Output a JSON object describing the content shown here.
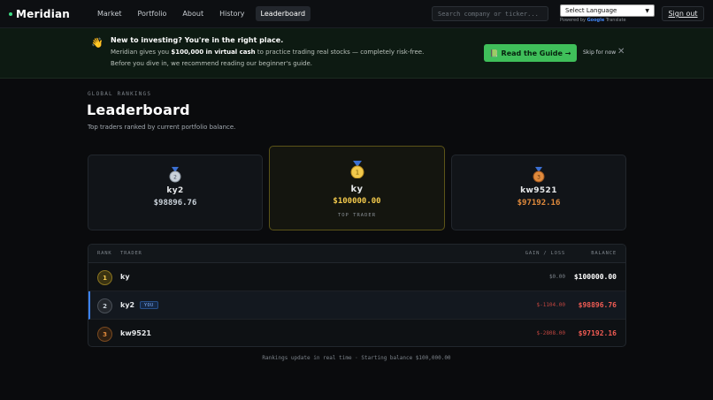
{
  "nav": {
    "brand": "Meridian",
    "links": [
      "Market",
      "Portfolio",
      "About",
      "History",
      "Leaderboard"
    ],
    "active_link": "Leaderboard",
    "search_placeholder": "Search company or ticker...",
    "language": "Select Language",
    "powered_prefix": "Powered by",
    "powered_brand": "Google",
    "powered_suffix": "Translate",
    "sign_out": "Sign out"
  },
  "banner": {
    "title": "New to investing? You're in the right place.",
    "line1_prefix": "Meridian gives you",
    "line1_bold": "$100,000 in virtual cash",
    "line1_suffix": "to practice trading real stocks — completely risk-free.",
    "line2": "Before you dive in, we recommend reading our beginner's guide.",
    "guide_button": "Read the Guide →",
    "skip": "Skip for now"
  },
  "header": {
    "eyebrow": "GLOBAL RANKINGS",
    "title": "Leaderboard",
    "subtitle": "Top traders ranked by current portfolio balance."
  },
  "podium": [
    {
      "place": 2,
      "name": "ky2",
      "balance": "$98896.76",
      "tag": ""
    },
    {
      "place": 1,
      "name": "ky",
      "balance": "$100000.00",
      "tag": "TOP TRADER"
    },
    {
      "place": 3,
      "name": "kw9521",
      "balance": "$97192.16",
      "tag": ""
    }
  ],
  "table": {
    "headers": {
      "rank": "RANK",
      "trader": "TRADER",
      "gain": "GAIN / LOSS",
      "balance": "BALANCE"
    },
    "rows": [
      {
        "rank": "1",
        "trader": "ky",
        "you": "",
        "gain": "$0.00",
        "balance": "$100000.00"
      },
      {
        "rank": "2",
        "trader": "ky2",
        "you": "YOU",
        "gain": "$-1104.00",
        "balance": "$98896.76"
      },
      {
        "rank": "3",
        "trader": "kw9521",
        "you": "",
        "gain": "$-2808.00",
        "balance": "$97192.16"
      }
    ]
  },
  "footnote": "Rankings update in real time · Starting balance $100,000.00",
  "colors": {
    "accent_green": "#3fbf5a",
    "gold": "#f2c94c",
    "silver": "#c9d1d9",
    "bronze": "#e08a3c",
    "loss_red": "#f25c54",
    "you_blue": "#3b82f6"
  }
}
